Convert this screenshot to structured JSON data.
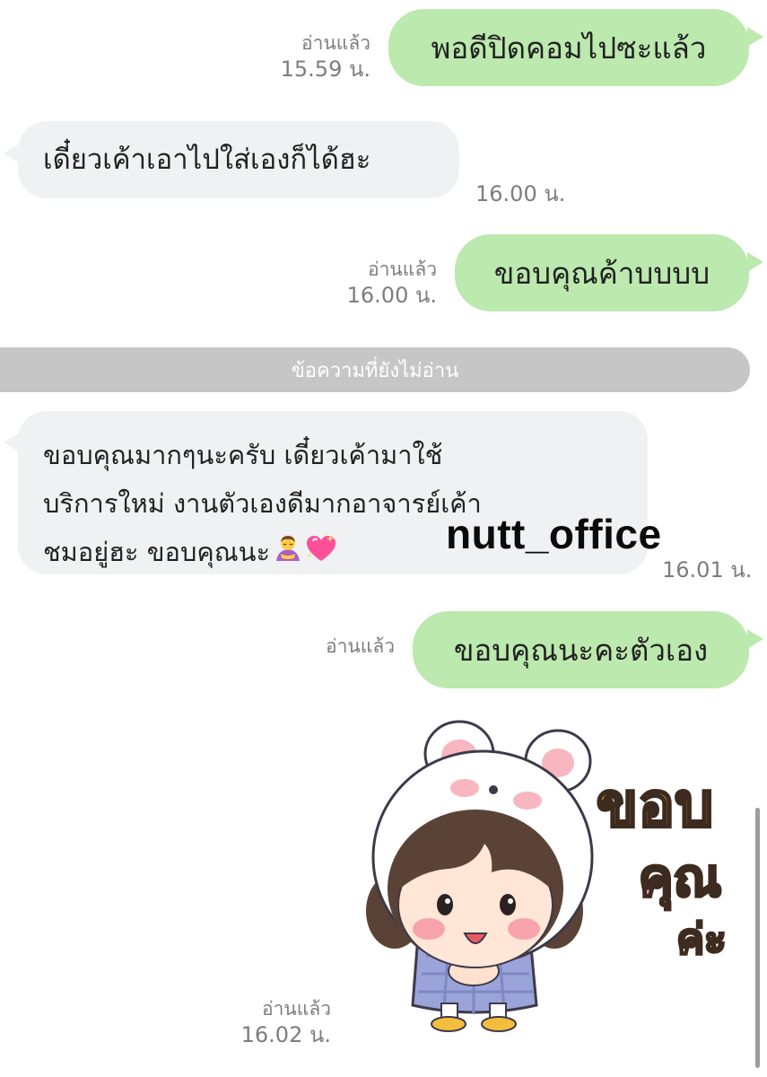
{
  "messages": [
    {
      "dir": "out",
      "text": "พอดีปิดคอมไปซะแล้ว",
      "read_label": "อ่านแล้ว",
      "time": "15.59 น."
    },
    {
      "dir": "in",
      "text": "เดี๋ยวเค้าเอาไปใส่เองก็ได้ฮะ",
      "time": "16.00 น."
    },
    {
      "dir": "out",
      "text": "ขอบคุณค้าบบบบ",
      "read_label": "อ่านแล้ว",
      "time": "16.00 น."
    },
    {
      "dir": "in",
      "lines": [
        "ขอบคุณมากๆนะครับ เดี๋ยวเค้ามาใช้",
        "บริการใหม่  งานตัวเองดีมากอาจารย์เค้า",
        "ชมอยู่ฮะ ขอบคุณนะ"
      ],
      "time": "16.01 น."
    },
    {
      "dir": "out",
      "text": "ขอบคุณนะคะตัวเอง",
      "read_label": "อ่านแล้ว"
    },
    {
      "dir": "out",
      "type": "sticker",
      "sticker_text": [
        "ขอบ",
        "คุณ",
        "ค่ะ"
      ],
      "read_label": "อ่านแล้ว",
      "time": "16.02 น."
    }
  ],
  "unread_divider": "ข้อความที่ยังไม่อ่าน",
  "watermark": "nutt_office",
  "icons": {
    "emoji_1": "person-bowing-emoji-icon",
    "emoji_2": "sparkling-heart-emoji-icon"
  },
  "colors": {
    "outgoing_bubble": "#bce9ae",
    "incoming_bubble": "#eff1f3",
    "divider": "#c6c6c6",
    "meta_text": "#7d7d7d"
  }
}
